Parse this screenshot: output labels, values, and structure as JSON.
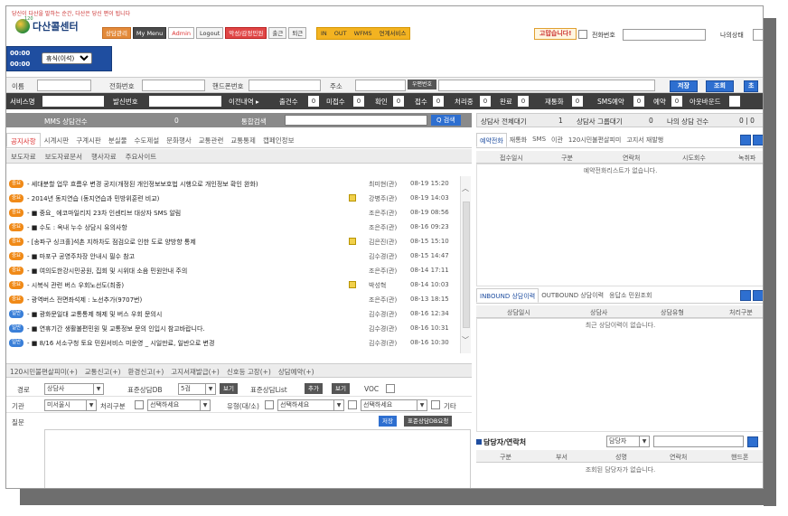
{
  "header": {
    "slogan": "당신이 다산을 말하는 순간, 다산은 당신 편이 됩니다",
    "logo_sub": "120",
    "logo_text": "다산콜센터",
    "buttons": [
      "상담관리",
      "My Menu",
      "Admin",
      "Logout",
      "악성/감정민원",
      "출근",
      "퇴근"
    ],
    "status_buttons": [
      "IN",
      "OUT",
      "WFMS",
      "연계서비스"
    ],
    "thanks": "고맙습니다!",
    "phone_label": "전화번호",
    "mystatus_label": "나의상태"
  },
  "timer": {
    "line1": "00:00",
    "line2": "00:00",
    "status_select": "휴식(이석)"
  },
  "customer": {
    "name_label": "이름",
    "phone_label": "전화번호",
    "mobile_label": "핸드폰번호",
    "address_label": "주소",
    "zip_button": "우편번호",
    "save_button": "저장",
    "search_button": "조회",
    "extra_button": "초"
  },
  "statusbar": {
    "service_label": "서비스명",
    "caller_label": "발신번호",
    "history_label": "이전내역 ▸",
    "items": [
      {
        "label": "출건수",
        "value": "0"
      },
      {
        "label": "미접수",
        "value": "0"
      },
      {
        "label": "확인",
        "value": "0"
      },
      {
        "label": "접수",
        "value": "0"
      },
      {
        "label": "처리중",
        "value": "0"
      },
      {
        "label": "완료",
        "value": "0"
      },
      {
        "label": "재통화",
        "value": "0"
      },
      {
        "label": "SMS예약",
        "value": "0"
      },
      {
        "label": "예약",
        "value": "0"
      },
      {
        "label": "아웃바운드",
        "value": ""
      }
    ]
  },
  "mms": {
    "label": "MMS 상담건수",
    "count": "0",
    "search_label": "통합검색",
    "search_button": "Q 검색"
  },
  "tabs_main": [
    "공지사항",
    "시계시판",
    "구계시판",
    "분실물",
    "수도제설",
    "문화행사",
    "교통관련",
    "교통통제",
    "캡페인정보"
  ],
  "tabs_sub": [
    "보도자료",
    "보도자료문서",
    "행사자료",
    "주요사이트"
  ],
  "notices": [
    {
      "badge": "중요",
      "type": "imp",
      "title": "- 세대분할 업무 흐름우 변경 공지(개정된 개인정보보호법 시행으로 개인정보 확인 완화)",
      "file": false,
      "author": "최미현(관)",
      "date": "08-19 15:20"
    },
    {
      "badge": "중요",
      "type": "imp",
      "title": "- 2014년 동지연습 (동지연습과 민방위훈련 비교)",
      "file": true,
      "author": "강병주(관)",
      "date": "08-19 14:03"
    },
    {
      "badge": "중요",
      "type": "imp",
      "title": "- ■ 중요_ 에코마일리지 23차 인센티브 대상자 SMS 알림",
      "file": false,
      "author": "조은주(관)",
      "date": "08-19 08:56"
    },
    {
      "badge": "중요",
      "type": "imp",
      "title": "- ■ 수도 : 옥내 누수 상담시 유의사항",
      "file": false,
      "author": "조은주(관)",
      "date": "08-16 09:23"
    },
    {
      "badge": "중요",
      "type": "imp",
      "title": "- [송파구 싱크홀]석촌 지하차도 점검으로 인한 도로 양방향 통제",
      "file": true,
      "author": "김은진(관)",
      "date": "08-15 15:10"
    },
    {
      "badge": "중요",
      "type": "imp",
      "title": "- ■ 마포구 공영주차장 안내시 필수 참고",
      "file": false,
      "author": "김수경(관)",
      "date": "08-15 14:47"
    },
    {
      "badge": "중요",
      "type": "imp",
      "title": "- ■ 여의도한강시민공원, 집회 및 시위대 소음 민원안내 주의",
      "file": false,
      "author": "조은주(관)",
      "date": "08-14 17:11"
    },
    {
      "badge": "중요",
      "type": "imp",
      "title": "- 시복식 관련 버스 우회노선도(최종)",
      "file": true,
      "author": "박성혁",
      "date": "08-14 10:03"
    },
    {
      "badge": "중요",
      "type": "imp",
      "title": "- 광역버스 전면좌석제 : 노선추가(9707번)",
      "file": false,
      "author": "조은주(관)",
      "date": "08-13 18:15"
    },
    {
      "badge": "일반",
      "type": "gen",
      "title": "- ■ 광화문일대 교통통제 해제 및 버스 우회 문의시",
      "file": false,
      "author": "김수경(관)",
      "date": "08-16 12:34"
    },
    {
      "badge": "일반",
      "type": "gen",
      "title": "- ■ 연휴기간 생활불편민원 및 교통정보 문의 인입시 참고바랍니다.",
      "file": false,
      "author": "김수경(관)",
      "date": "08-16 10:31"
    },
    {
      "badge": "일반",
      "type": "gen",
      "title": "- ■ 8/16 서소구청 토요 민원서비스 미운영 _ 시일만료, 일반으로 변경",
      "file": false,
      "author": "김수경(관)",
      "date": "08-16 10:30"
    }
  ],
  "tabs_bottom": [
    "120시민불편살피미(+)",
    "교통신고(+)",
    "환경신고(+)",
    "고지서재발급(+)",
    "신호등 고장(+)",
    "상담예약(+)"
  ],
  "form": {
    "route_label": "경로",
    "route_value": "상담사",
    "stddb_label": "표준상담DB",
    "stddb_value": "5검",
    "view_btn": "보기",
    "stdlist_label": "표준상담List",
    "add_btn": "추가",
    "view_btn2": "보기",
    "voc_label": "VOC",
    "org_label": "기관",
    "org_value": "미서울시",
    "proc_label": "처리구분",
    "proc_value": "선택하세요",
    "type_label": "유형(대/소)",
    "type_value1": "선택하세요",
    "type_value2": "선택하세요",
    "etc_label": "기타",
    "question_label": "질문",
    "save_btn": "저장",
    "stddb_reg_btn": "표준상담DB요청"
  },
  "right": {
    "top_items": [
      "상담사 전체대기",
      "1",
      "상담사 그룹대기",
      "0",
      "나의 상담 건수",
      "0 | 0"
    ],
    "tabs1": [
      "예약전화",
      "재통화",
      "SMS",
      "이관",
      "120시민불편살피미",
      "고지서 재발행"
    ],
    "table1_headers": [
      "접수일시",
      "구분",
      "연락처",
      "시도회수",
      "녹취파"
    ],
    "table1_empty": "예약전화리스트가 없습니다.",
    "tabs2": [
      "INBOUND 상담이력",
      "OUTBOUND 상담이력",
      "응답소 민원조회"
    ],
    "table2_headers": [
      "상담일시",
      "상담사",
      "상담유형",
      "처리구분"
    ],
    "table2_empty": "최근 상담이력이 없습니다.",
    "contact_title": "담당자/연락처",
    "contact_select": "담당자",
    "table3_headers": [
      "구분",
      "부서",
      "성명",
      "연락처",
      "핸드폰"
    ],
    "table3_empty": "조회된 담당자가 없습니다."
  },
  "colors": {
    "accent_blue": "#2e6fd0",
    "timer_blue": "#1f4ea0",
    "badge_important": "#f08a18",
    "badge_general": "#3a7fd8",
    "status_yellow": "#f3b321"
  }
}
